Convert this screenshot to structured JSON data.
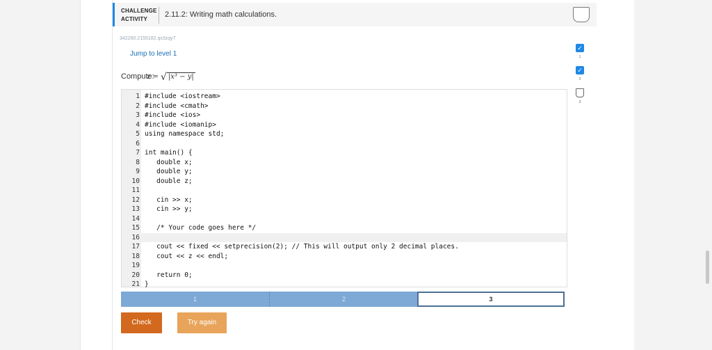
{
  "header": {
    "kind_line1": "CHALLENGE",
    "kind_line2": "ACTIVITY",
    "title": "2.11.2: Writing math calculations."
  },
  "activity_id": "342260.2155182.qx3zqy7",
  "jump_label": "Jump to level 1",
  "compute_label": "Compute:",
  "formula": {
    "lhs": "z =",
    "radicand": "|x³ − y|"
  },
  "code_lines": [
    {
      "n": "1",
      "t": "#include <iostream>"
    },
    {
      "n": "2",
      "t": "#include <cmath>"
    },
    {
      "n": "3",
      "t": "#include <ios>"
    },
    {
      "n": "4",
      "t": "#include <iomanip>"
    },
    {
      "n": "5",
      "t": "using namespace std;"
    },
    {
      "n": "6",
      "t": ""
    },
    {
      "n": "7",
      "t": "int main() {"
    },
    {
      "n": "8",
      "t": "   double x;"
    },
    {
      "n": "9",
      "t": "   double y;"
    },
    {
      "n": "10",
      "t": "   double z;"
    },
    {
      "n": "11",
      "t": ""
    },
    {
      "n": "12",
      "t": "   cin >> x;"
    },
    {
      "n": "13",
      "t": "   cin >> y;"
    },
    {
      "n": "14",
      "t": ""
    },
    {
      "n": "15",
      "t": "   /* Your code goes here */"
    },
    {
      "n": "16",
      "t": ""
    },
    {
      "n": "17",
      "t": "   cout << fixed << setprecision(2); // This will output only 2 decimal places."
    },
    {
      "n": "18",
      "t": "   cout << z << endl;"
    },
    {
      "n": "19",
      "t": ""
    },
    {
      "n": "20",
      "t": "   return 0;"
    },
    {
      "n": "21",
      "t": "}"
    }
  ],
  "active_line": "16",
  "progress": {
    "segments": [
      "1",
      "2",
      "3"
    ],
    "current": "3"
  },
  "buttons": {
    "check": "Check",
    "try_again": "Try again"
  },
  "levels": [
    {
      "label": "1",
      "status": "complete"
    },
    {
      "label": "2",
      "status": "complete"
    },
    {
      "label": "3",
      "status": "incomplete"
    }
  ],
  "colors": {
    "accent": "#1e88e5",
    "check": "#d2691e",
    "try_again": "#e8a45a",
    "progress": "#7ea8d6"
  }
}
